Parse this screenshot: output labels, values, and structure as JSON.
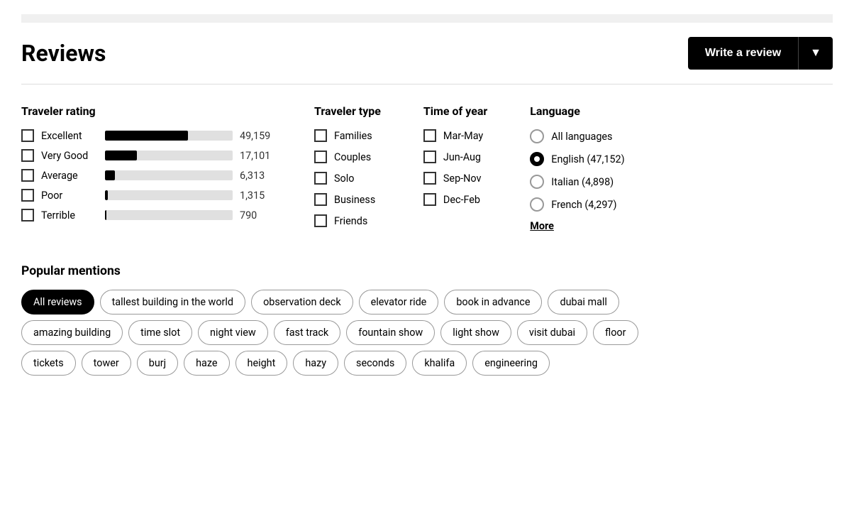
{
  "header": {
    "title": "Reviews",
    "write_review_label": "Write a review"
  },
  "traveler_rating": {
    "title": "Traveler rating",
    "rows": [
      {
        "label": "Excellent",
        "bar_percent": 65,
        "count": "49,159"
      },
      {
        "label": "Very Good",
        "bar_percent": 25,
        "count": "17,101"
      },
      {
        "label": "Average",
        "bar_percent": 8,
        "count": "6,313"
      },
      {
        "label": "Poor",
        "bar_percent": 2,
        "count": "1,315"
      },
      {
        "label": "Terrible",
        "bar_percent": 1,
        "count": "790"
      }
    ]
  },
  "traveler_type": {
    "title": "Traveler type",
    "options": [
      {
        "label": "Families"
      },
      {
        "label": "Couples"
      },
      {
        "label": "Solo"
      },
      {
        "label": "Business"
      },
      {
        "label": "Friends"
      }
    ]
  },
  "time_of_year": {
    "title": "Time of year",
    "options": [
      {
        "label": "Mar-May"
      },
      {
        "label": "Jun-Aug"
      },
      {
        "label": "Sep-Nov"
      },
      {
        "label": "Dec-Feb"
      }
    ]
  },
  "language": {
    "title": "Language",
    "options": [
      {
        "label": "All languages",
        "selected": false
      },
      {
        "label": "English (47,152)",
        "selected": true
      },
      {
        "label": "Italian (4,898)",
        "selected": false
      },
      {
        "label": "French (4,297)",
        "selected": false
      }
    ],
    "more_label": "More"
  },
  "popular_mentions": {
    "title": "Popular mentions",
    "rows": [
      [
        {
          "label": "All reviews",
          "active": true
        },
        {
          "label": "tallest building in the world",
          "active": false
        },
        {
          "label": "observation deck",
          "active": false
        },
        {
          "label": "elevator ride",
          "active": false
        },
        {
          "label": "book in advance",
          "active": false
        },
        {
          "label": "dubai mall",
          "active": false
        }
      ],
      [
        {
          "label": "amazing building",
          "active": false
        },
        {
          "label": "time slot",
          "active": false
        },
        {
          "label": "night view",
          "active": false
        },
        {
          "label": "fast track",
          "active": false
        },
        {
          "label": "fountain show",
          "active": false
        },
        {
          "label": "light show",
          "active": false
        },
        {
          "label": "visit dubai",
          "active": false
        },
        {
          "label": "floor",
          "active": false
        }
      ],
      [
        {
          "label": "tickets",
          "active": false
        },
        {
          "label": "tower",
          "active": false
        },
        {
          "label": "burj",
          "active": false
        },
        {
          "label": "haze",
          "active": false
        },
        {
          "label": "height",
          "active": false
        },
        {
          "label": "hazy",
          "active": false
        },
        {
          "label": "seconds",
          "active": false
        },
        {
          "label": "khalifa",
          "active": false
        },
        {
          "label": "engineering",
          "active": false
        }
      ]
    ]
  }
}
